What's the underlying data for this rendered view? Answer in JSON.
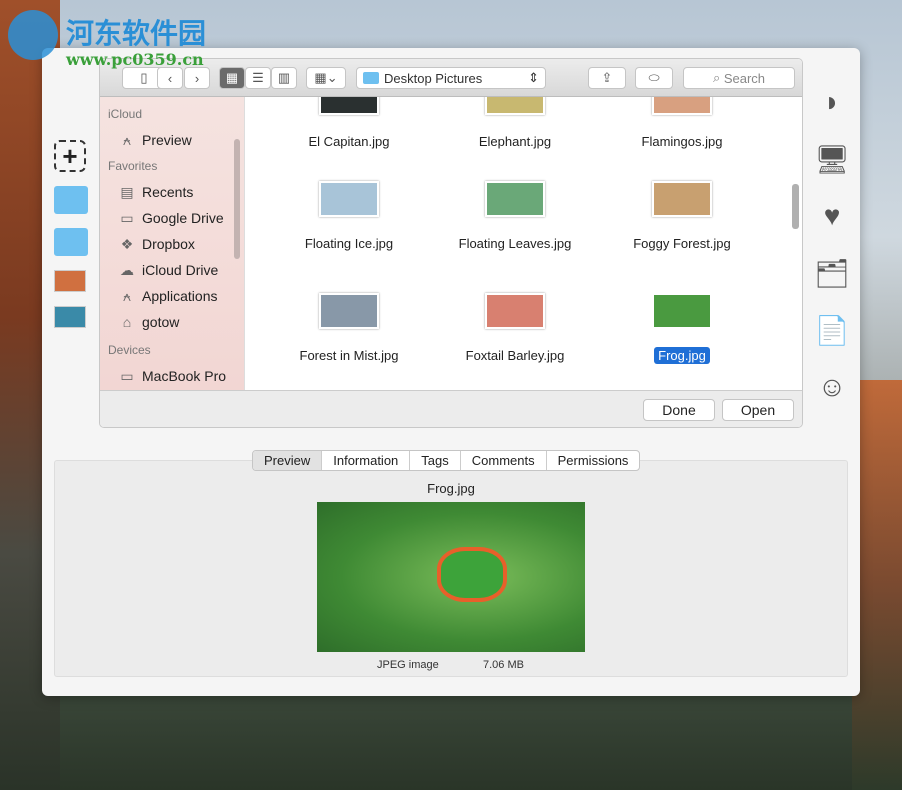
{
  "watermark": {
    "site_name": "河东软件园",
    "url": "www.pc0359.cn"
  },
  "toolbar": {
    "location": "Desktop Pictures",
    "search_placeholder": "Search"
  },
  "sidebar": {
    "sections": [
      {
        "header": "iCloud",
        "items": [
          {
            "label": "Preview",
            "icon": "applications-icon"
          }
        ]
      },
      {
        "header": "Favorites",
        "items": [
          {
            "label": "Recents",
            "icon": "recents-icon"
          },
          {
            "label": "Google Drive",
            "icon": "folder-icon"
          },
          {
            "label": "Dropbox",
            "icon": "dropbox-icon"
          },
          {
            "label": "iCloud Drive",
            "icon": "cloud-icon"
          },
          {
            "label": "Applications",
            "icon": "applications-icon"
          },
          {
            "label": "gotow",
            "icon": "home-icon"
          }
        ]
      },
      {
        "header": "Devices",
        "items": [
          {
            "label": "MacBook Pro",
            "icon": "laptop-icon"
          }
        ]
      }
    ]
  },
  "files": [
    {
      "name": "El Capitan.jpg",
      "color": "#2a3030"
    },
    {
      "name": "Elephant.jpg",
      "color": "#c8b870"
    },
    {
      "name": "Flamingos.jpg",
      "color": "#d8a080"
    },
    {
      "name": "Floating Ice.jpg",
      "color": "#a8c4d8"
    },
    {
      "name": "Floating Leaves.jpg",
      "color": "#6aa878"
    },
    {
      "name": "Foggy Forest.jpg",
      "color": "#c8a070"
    },
    {
      "name": "Forest in Mist.jpg",
      "color": "#8898a8"
    },
    {
      "name": "Foxtail Barley.jpg",
      "color": "#d88070"
    },
    {
      "name": "Frog.jpg",
      "color": "#4a9a40",
      "selected": true
    }
  ],
  "buttons": {
    "done": "Done",
    "open": "Open"
  },
  "info": {
    "tabs": [
      "Preview",
      "Information",
      "Tags",
      "Comments",
      "Permissions"
    ],
    "active_tab": "Preview",
    "filename": "Frog.jpg",
    "kind": "JPEG image",
    "size": "7.06 MB"
  }
}
